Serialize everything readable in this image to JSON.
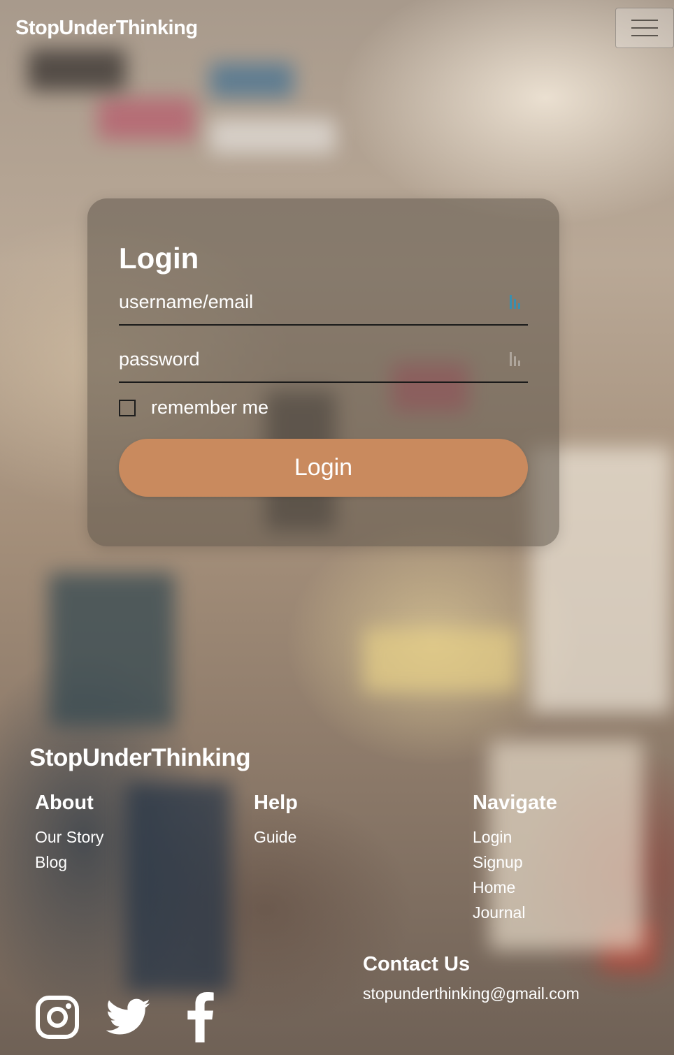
{
  "header": {
    "brand": "StopUnderThinking",
    "menu_icon": "hamburger-menu-icon"
  },
  "login_form": {
    "title": "Login",
    "username_placeholder": "username/email",
    "password_placeholder": "password",
    "remember_label": "remember me",
    "remember_checked": false,
    "submit_label": "Login",
    "field_icon": "key-icon",
    "accent_color": "#c98a5e"
  },
  "footer": {
    "brand": "StopUnderThinking",
    "columns": [
      {
        "title": "About",
        "links": [
          "Our Story",
          "Blog"
        ]
      },
      {
        "title": "Help",
        "links": [
          "Guide"
        ]
      },
      {
        "title": "Navigate",
        "links": [
          "Login",
          "Signup",
          "Home",
          "Journal"
        ]
      }
    ],
    "contact": {
      "title": "Contact Us",
      "email": "stopunderthinking@gmail.com"
    },
    "social_icons": [
      "instagram-icon",
      "twitter-icon",
      "facebook-icon"
    ]
  }
}
